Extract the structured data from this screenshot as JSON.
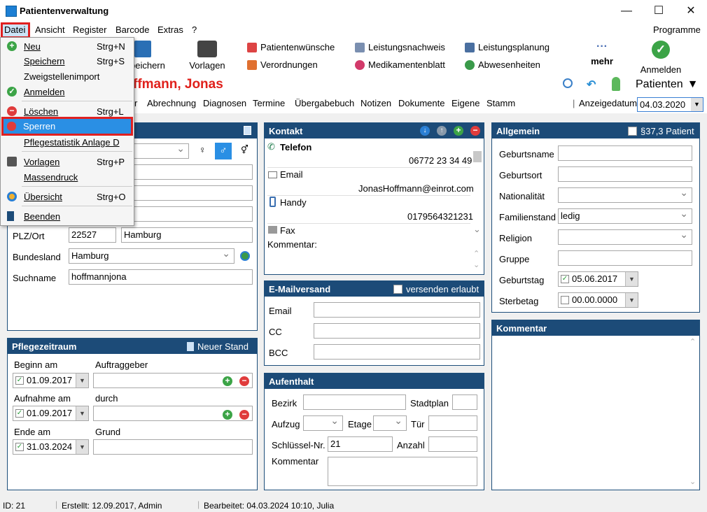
{
  "window": {
    "title": "Patientenverwaltung",
    "min": "—",
    "max": "☐",
    "close": "✕"
  },
  "menu": {
    "items": [
      "Datei",
      "Ansicht",
      "Register",
      "Barcode",
      "Extras",
      "?"
    ],
    "programme": "Programme"
  },
  "toolbar": {
    "speichern": "peichern",
    "vorlagen": "Vorlagen",
    "patientenwuensche": "Patientenwünsche",
    "verordnungen": "Verordnungen",
    "leistungsnachweis": "Leistungsnachweis",
    "medikamentenblatt": "Medikamentenblatt",
    "leistungsplanung": "Leistungsplanung",
    "abwesenheiten": "Abwesenheiten",
    "mehr_dots": "···",
    "mehr": "mehr",
    "anmelden": "Anmelden"
  },
  "header": {
    "patient_name": "ffmann, Jonas",
    "patienten": "Patienten"
  },
  "nav": {
    "tabs": [
      "r",
      "Abrechnung",
      "Diagnosen",
      "Termine",
      "Übergabebuch",
      "Notizen",
      "Dokumente",
      "Eigene",
      "Stamm"
    ],
    "anzeigedatum_label": "Anzeigedatum",
    "anzeigedatum": "04.03.2020",
    "pipe": "|"
  },
  "dropdown": {
    "items": [
      {
        "label": "Neu",
        "shortcut": "Strg+N"
      },
      {
        "label": "Speichern",
        "shortcut": "Strg+S"
      },
      {
        "label": "Zweigstellenimport",
        "shortcut": ""
      },
      {
        "label": "Anmelden",
        "shortcut": ""
      },
      {
        "label": "Löschen",
        "shortcut": "Strg+L"
      },
      {
        "label": "Sperren",
        "shortcut": ""
      },
      {
        "label": "Pflegestatistik Anlage D",
        "shortcut": ""
      },
      {
        "label": "Vorlagen",
        "shortcut": "Strg+P"
      },
      {
        "label": "Massendruck",
        "shortcut": ""
      },
      {
        "label": "Übersicht",
        "shortcut": "Strg+O"
      },
      {
        "label": "Beenden",
        "shortcut": ""
      }
    ]
  },
  "person": {
    "gender_female": "♀",
    "gender_male": "♂",
    "gender_diverse": "⚥",
    "plzort_label": "PLZ/Ort",
    "plz": "22527",
    "ort": "Hamburg",
    "bundesland_label": "Bundesland",
    "bundesland": "Hamburg",
    "suchname_label": "Suchname",
    "suchname": "hoffmannjona"
  },
  "kontakt": {
    "title": "Kontakt",
    "telefon_label": "Telefon",
    "telefon": "06772 23 34 49",
    "email_label": "Email",
    "email": "JonasHoffmann@einrot.com",
    "handy_label": "Handy",
    "handy": "0179564321231",
    "fax_label": "Fax",
    "kommentar_label": "Kommentar:"
  },
  "emailversand": {
    "title": "E-Mailversand",
    "versenden_label": "versenden erlaubt",
    "email_label": "Email",
    "cc_label": "CC",
    "bcc_label": "BCC"
  },
  "aufenthalt": {
    "title": "Aufenthalt",
    "bezirk": "Bezirk",
    "stadtplan": "Stadtplan",
    "aufzug": "Aufzug",
    "etage": "Etage",
    "tuer": "Tür",
    "schluessel_label": "Schlüssel-Nr.",
    "schluessel": "21",
    "anzahl": "Anzahl",
    "kommentar": "Kommentar"
  },
  "allgemein": {
    "title": "Allgemein",
    "p37_label": "§37,3 Patient",
    "geburtsname": "Geburtsname",
    "geburtsort": "Geburtsort",
    "nationalitaet": "Nationalität",
    "familienstand_label": "Familienstand",
    "familienstand": "ledig",
    "religion": "Religion",
    "gruppe": "Gruppe",
    "geburtstag_label": "Geburtstag",
    "geburtstag": "05.06.2017",
    "sterbetag_label": "Sterbetag",
    "sterbetag": "00.00.0000"
  },
  "kommentar": {
    "title": "Kommentar"
  },
  "pflegezeitraum": {
    "title": "Pflegezeitraum",
    "neuer_stand": "Neuer Stand",
    "beginn_label": "Beginn am",
    "beginn": "01.09.2017",
    "auftraggeber_label": "Auftraggeber",
    "aufnahme_label": "Aufnahme am",
    "aufnahme": "01.09.2017",
    "durch_label": "durch",
    "ende_label": "Ende am",
    "ende": "31.03.2024",
    "grund_label": "Grund"
  },
  "status": {
    "id": "ID: 21",
    "erstellt": "Erstellt: 12.09.2017, Admin",
    "bearbeitet": "Bearbeitet: 04.03.2024 10:10, Julia"
  },
  "colors": {
    "accent": "#1c4b78",
    "highlight": "#e02020",
    "selection": "#2a7fd4",
    "name_red": "#e0201b"
  }
}
